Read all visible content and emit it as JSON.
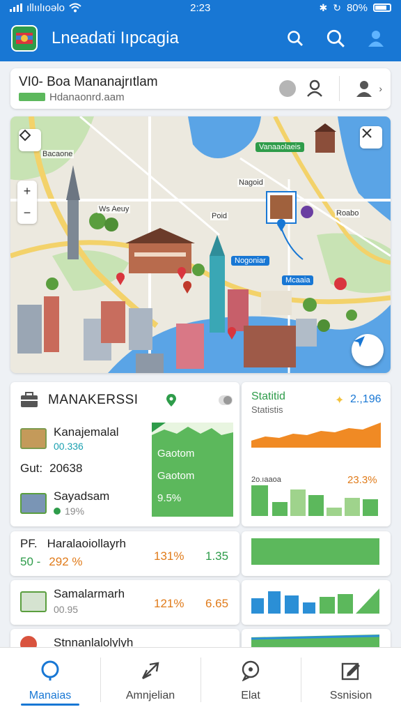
{
  "status_bar": {
    "carrier": "ıllıılıoǝlo",
    "time": "2:23",
    "battery": "80%"
  },
  "app": {
    "title": "Lneadati Iıpcagia"
  },
  "location": {
    "line1": "VI0-  Boa Mananajrıtlam",
    "line2": "Hdanaonrd.aam"
  },
  "map": {
    "labels": [
      "Bacaone",
      "Ws Aeuy",
      "Poid",
      "Nagoid",
      "Roabo"
    ],
    "tags": [
      {
        "text": "Vanaaolaeis",
        "color": "#2e9c4a"
      },
      {
        "text": "Nogoniar",
        "color": "#1877d4"
      },
      {
        "text": "Mcaaia",
        "color": "#1877d4"
      }
    ]
  },
  "panel_main": {
    "title": "MANAKERSSI",
    "item1_label": "Kanajemalal",
    "item1_value": "00.336",
    "gut_label": "Gut:",
    "gut_value": "20638",
    "item2_label": "Sayadsam",
    "item2_value": "19%",
    "card_line1": "Gaotom",
    "card_line2": "Gaotom",
    "card_value": "9.5%"
  },
  "panel_stats": {
    "title": "Statitid",
    "subtitle": "Statistis",
    "value": "2.,196",
    "chart_label": "2o.ıaaoa",
    "chart_value": "23.3%"
  },
  "row1": {
    "label_prefix": "PF.",
    "label": "Haralaoiollayrh",
    "value_prefix": "50 -",
    "pct": "292 %",
    "v1": "131%",
    "v2": "1.35"
  },
  "row2": {
    "label": "Samalarmarh",
    "sub": "00.95",
    "v1": "121%",
    "v2": "6.65"
  },
  "row3": {
    "label": "Stnnanlalolylyh"
  },
  "nav": [
    {
      "label": "Manaias",
      "icon": "search-icon"
    },
    {
      "label": "Amnjelian",
      "icon": "plane-icon"
    },
    {
      "label": "Elat",
      "icon": "chat-icon"
    },
    {
      "label": "Ssnision",
      "icon": "edit-icon"
    }
  ],
  "colors": {
    "primary": "#1877d4",
    "green": "#5cb85c",
    "orange": "#e07b1a"
  }
}
